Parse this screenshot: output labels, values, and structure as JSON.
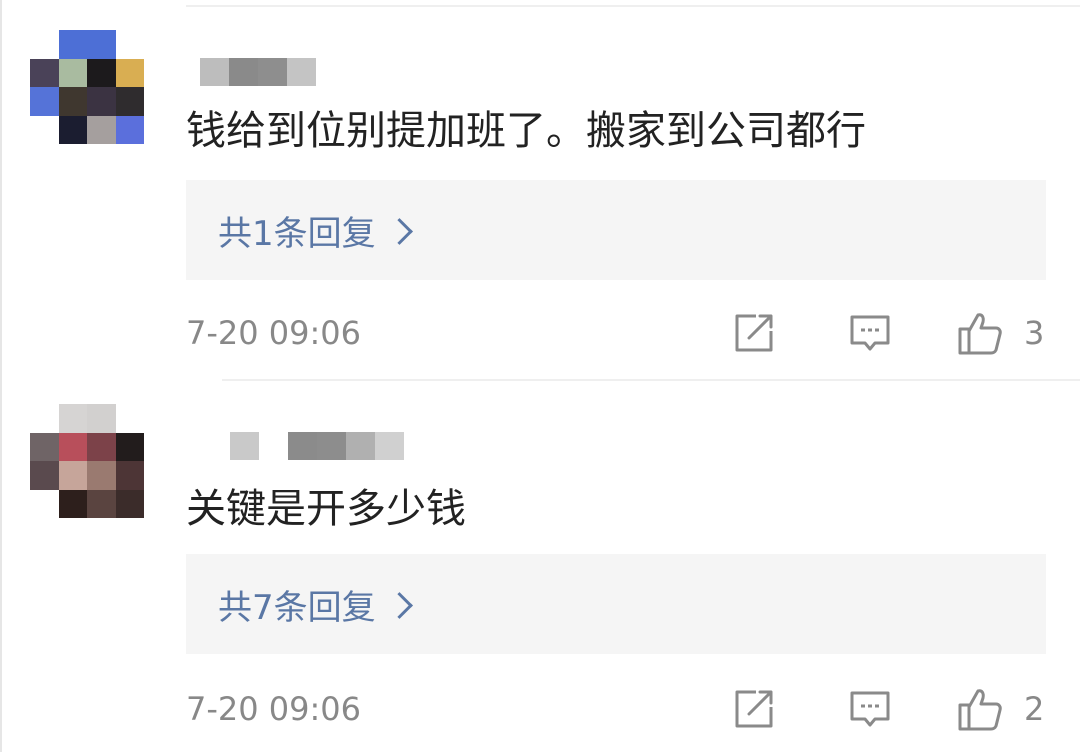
{
  "comments": [
    {
      "text": "钱给到位别提加班了。搬家到公司都行",
      "reply_summary": "共1条回复",
      "timestamp": "7-20 09:06",
      "likes": "3",
      "avatar_colors": [
        "#ffffff",
        "#4d6fd6",
        "#4d6fd6",
        "#ffffff",
        "#4a4258",
        "#a9bba0",
        "#1c1a1c",
        "#d9ae52",
        "#5573d8",
        "#3f372f",
        "#3b3342",
        "#2f2c2e",
        "#ffffff",
        "#1b1d30",
        "#a59f9e",
        "#5b6fdc"
      ],
      "username_blocks": [
        "#bdbdbd",
        "#8a8a8a",
        "#8e8e8e",
        "#c4c4c4"
      ]
    },
    {
      "text": "关键是开多少钱",
      "reply_summary": "共7条回复",
      "timestamp": "7-20 09:06",
      "likes": "2",
      "avatar_colors": [
        "#ffffff",
        "#d6d4d3",
        "#d2d0cf",
        "#ffffff",
        "#6f6466",
        "#b84f5b",
        "#7c4249",
        "#221c1c",
        "#5a4a4e",
        "#c6a59a",
        "#9a7a70",
        "#4d3536",
        "#ffffff",
        "#2d1f1c",
        "#5a4440",
        "#3b2c2a"
      ],
      "username_blocks": [
        "#c9c9c9",
        "#ffffff",
        "#8b8b8b",
        "#8d8d8d",
        "#b0b0b0",
        "#d0d0d0"
      ]
    }
  ],
  "icons": {
    "share": "share-icon",
    "reply": "comment-icon",
    "like": "thumbs-up-icon"
  },
  "colors": {
    "link": "#5a77a5",
    "meta_gray": "#888888",
    "reply_bg": "#f5f5f5"
  }
}
